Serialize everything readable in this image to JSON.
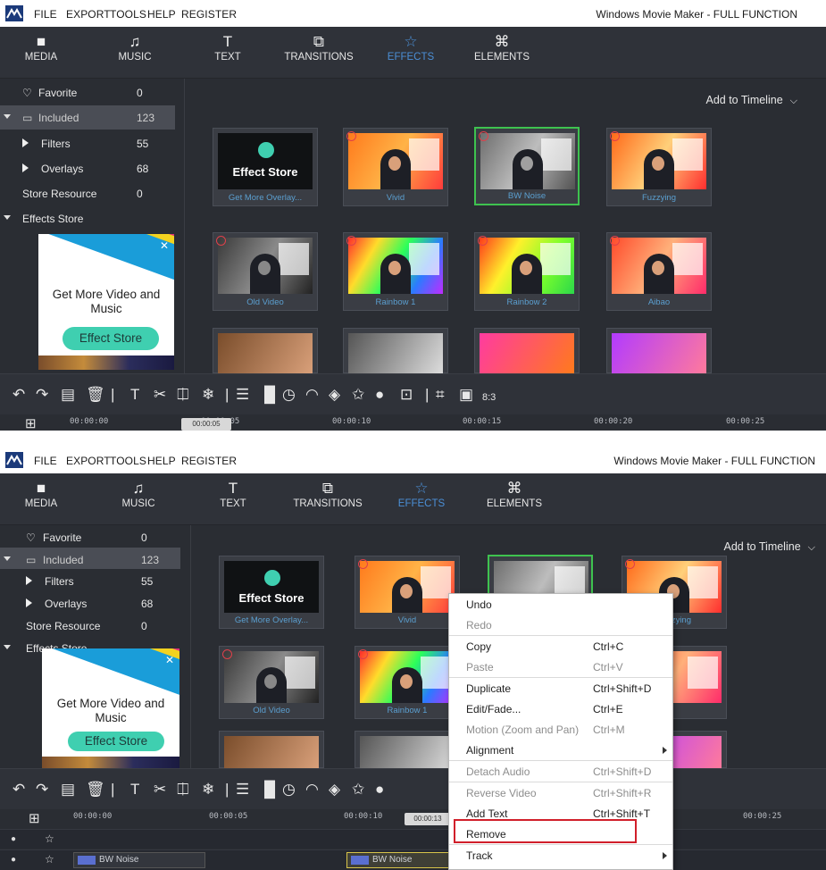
{
  "app": {
    "menu": [
      "FILE",
      "EXPORT",
      "TOOLS",
      "HELP",
      "REGISTER"
    ],
    "title": "Windows Movie Maker - FULL FUNCTION"
  },
  "toolbar": {
    "tabs": [
      {
        "label": "MEDIA",
        "icon": "folder-icon"
      },
      {
        "label": "MUSIC",
        "icon": "music-icon"
      },
      {
        "label": "TEXT",
        "icon": "text-icon"
      },
      {
        "label": "TRANSITIONS",
        "icon": "transitions-icon"
      },
      {
        "label": "EFFECTS",
        "icon": "effects-icon"
      },
      {
        "label": "ELEMENTS",
        "icon": "elements-icon"
      }
    ],
    "active": "EFFECTS",
    "active_color": "#4b8fd6"
  },
  "sidebar": {
    "items": [
      {
        "label": "Favorite",
        "count": "0"
      },
      {
        "label": "Included",
        "count": "123"
      },
      {
        "label": "Filters",
        "count": "55"
      },
      {
        "label": "Overlays",
        "count": "68"
      },
      {
        "label": "Store Resource",
        "count": "0"
      },
      {
        "label": "Effects Store",
        "count": ""
      }
    ]
  },
  "ad": {
    "headline": "Get More Video and Music",
    "button": "Effect Store",
    "button_color": "#3fcfb0"
  },
  "content": {
    "add_to_timeline": "Add to Timeline",
    "effects": [
      {
        "name": "Get More Overlay...",
        "store_label": "Effect Store"
      },
      {
        "name": "Vivid"
      },
      {
        "name": "BW Noise"
      },
      {
        "name": "Fuzzying"
      },
      {
        "name": "Old Video"
      },
      {
        "name": "Rainbow 1"
      },
      {
        "name": "Rainbow 2"
      },
      {
        "name": "Aibao"
      }
    ],
    "selected_effect": "BW Noise",
    "selected_color": "#3ec24f"
  },
  "timeline": {
    "shot1_times": [
      "00:00:00",
      "00:00:05",
      "00:00:10",
      "00:00:15",
      "00:00:20",
      "00:00:25"
    ],
    "shot1_playhead": "00:00:05",
    "shot2_times": [
      "00:00:00",
      "00:00:05",
      "00:00:10",
      "00:00:25"
    ],
    "shot2_playhead": "00:00:13",
    "ratio_label": "8:3",
    "clips": [
      {
        "label": "BW Noise"
      },
      {
        "label": "BW Noise"
      }
    ]
  },
  "context_menu": {
    "items": [
      {
        "label": "Undo",
        "shortcut": "",
        "disabled": false
      },
      {
        "label": "Redo",
        "shortcut": "",
        "disabled": true
      },
      {
        "label": "Copy",
        "shortcut": "Ctrl+C",
        "disabled": false
      },
      {
        "label": "Paste",
        "shortcut": "Ctrl+V",
        "disabled": true
      },
      {
        "label": "Duplicate",
        "shortcut": "Ctrl+Shift+D",
        "disabled": false
      },
      {
        "label": "Edit/Fade...",
        "shortcut": "Ctrl+E",
        "disabled": false
      },
      {
        "label": "Motion (Zoom and Pan)",
        "shortcut": "Ctrl+M",
        "disabled": true
      },
      {
        "label": "Alignment",
        "shortcut": "",
        "disabled": false
      },
      {
        "label": "Detach Audio",
        "shortcut": "Ctrl+Shift+D",
        "disabled": true
      },
      {
        "label": "Reverse Video",
        "shortcut": "Ctrl+Shift+R",
        "disabled": true
      },
      {
        "label": "Add Text",
        "shortcut": "Ctrl+Shift+T",
        "disabled": false
      },
      {
        "label": "Remove",
        "shortcut": "",
        "disabled": false
      },
      {
        "label": "Track",
        "shortcut": "",
        "disabled": false
      }
    ],
    "highlighted": "Remove",
    "highlight_color": "#d11f2a"
  }
}
